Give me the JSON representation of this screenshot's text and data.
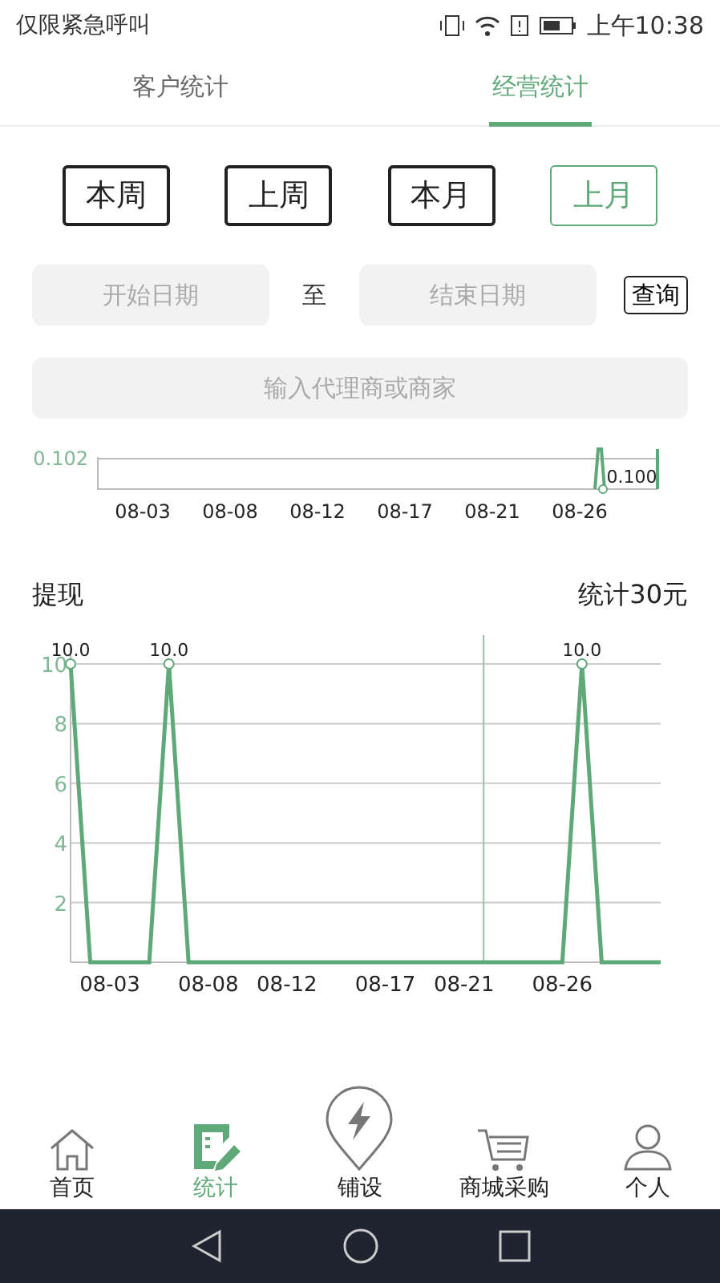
{
  "status_bar": {
    "carrier": "仅限紧急呼叫",
    "time": "上午10:38"
  },
  "tabs": [
    {
      "label": "客户统计",
      "selected": false
    },
    {
      "label": "经营统计",
      "selected": true
    }
  ],
  "periods": [
    {
      "label": "本周",
      "selected": false
    },
    {
      "label": "上周",
      "selected": false
    },
    {
      "label": "本月",
      "selected": false
    },
    {
      "label": "上月",
      "selected": true
    }
  ],
  "date_range": {
    "start_placeholder": "开始日期",
    "separator": "至",
    "end_placeholder": "结束日期",
    "query_button": "查询"
  },
  "search": {
    "placeholder": "输入代理商或商家"
  },
  "mini_chart": {
    "y_label": "0.102",
    "point_label": "0.100",
    "x_labels": [
      "08-03",
      "08-08",
      "08-12",
      "08-17",
      "08-21",
      "08-26"
    ]
  },
  "section": {
    "title": "提现",
    "total": "统计30元"
  },
  "chart_data": {
    "type": "line",
    "categories": [
      null,
      null,
      "08-03",
      null,
      null,
      null,
      null,
      "08-08",
      null,
      null,
      null,
      "08-12",
      null,
      null,
      null,
      null,
      "08-17",
      null,
      null,
      null,
      "08-21",
      null,
      null,
      null,
      null,
      "08-26",
      null,
      null,
      null,
      null,
      null
    ],
    "series": [
      {
        "color": "#5fa878",
        "values": [
          10,
          0,
          0,
          0,
          0,
          10,
          0,
          0,
          0,
          0,
          0,
          0,
          0,
          0,
          0,
          0,
          0,
          0,
          0,
          0,
          0,
          0,
          0,
          0,
          0,
          0,
          10,
          0,
          0,
          0,
          0
        ]
      }
    ],
    "value_labels": [
      "10.0",
      null,
      null,
      null,
      null,
      "10.0",
      null,
      null,
      null,
      null,
      null,
      null,
      null,
      null,
      null,
      null,
      null,
      null,
      null,
      null,
      null,
      null,
      null,
      null,
      null,
      null,
      "10.0",
      null,
      null,
      null,
      null
    ],
    "ylim": [
      0,
      10
    ],
    "yticks": [
      2,
      4,
      6,
      8,
      10
    ],
    "grid": true
  },
  "bottom_nav": [
    {
      "label": "首页",
      "selected": false
    },
    {
      "label": "统计",
      "selected": true
    },
    {
      "label": "铺设",
      "selected": false
    },
    {
      "label": "商城采购",
      "selected": false
    },
    {
      "label": "个人",
      "selected": false
    }
  ]
}
